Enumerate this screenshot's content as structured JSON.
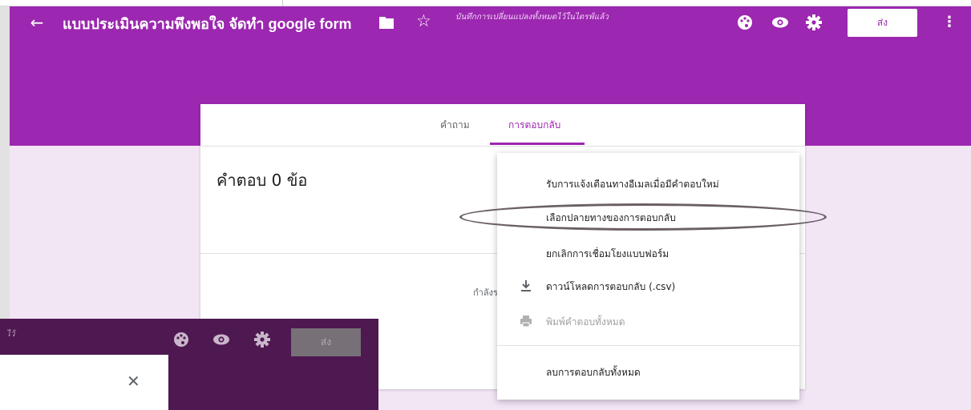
{
  "header": {
    "back_icon": "arrow-left-icon",
    "title": "แบบประเมินความพึงพอใจ จัดทำ google form",
    "save_status": "บันทึกการเปลี่ยนแปลงทั้งหมดไว้ในไดรฟ์แล้ว",
    "send_label": "ส่ง",
    "icons": [
      "folder-icon",
      "star-icon",
      "palette-icon",
      "eye-icon",
      "gear-icon",
      "more-vertical-icon"
    ],
    "accent_color": "#9c27b0"
  },
  "tabs": {
    "questions": "คำถาม",
    "responses": "การตอบกลับ",
    "active": "responses"
  },
  "responses": {
    "count_label": "คำตอบ 0 ข้อ",
    "waiting_text": "กำลังร"
  },
  "menu": {
    "items": [
      {
        "label": "รับการแจ้งเตือนทางอีเมลเมื่อมีคำตอบใหม่",
        "icon": "",
        "disabled": false
      },
      {
        "label": "เลือกปลายทางของการตอบกลับ",
        "icon": "",
        "disabled": false,
        "highlighted": true
      },
      {
        "label": "ยกเลิกการเชื่อมโยงแบบฟอร์ม",
        "icon": "",
        "disabled": false
      },
      {
        "label": "ดาวน์โหลดการตอบกลับ (.csv)",
        "icon": "download-icon",
        "disabled": false
      },
      {
        "label": "พิมพ์คำตอบทั้งหมด",
        "icon": "print-icon",
        "disabled": true
      },
      {
        "label": "ลบการตอบกลับทั้งหมด",
        "icon": "",
        "disabled": false
      }
    ]
  },
  "inset": {
    "status_fragment": "ไว้",
    "send_label": "ส่ง",
    "close_icon": "close-icon"
  }
}
